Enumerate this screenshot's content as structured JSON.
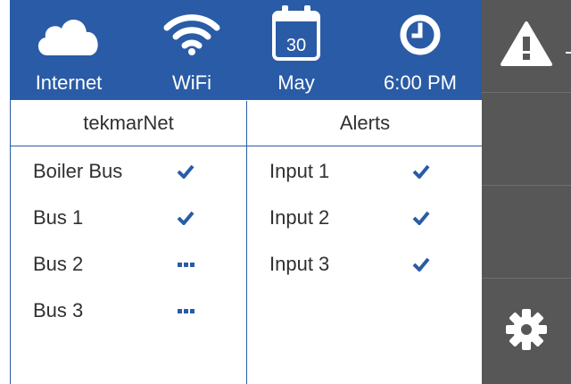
{
  "header": {
    "internet_label": "Internet",
    "wifi_label": "WiFi",
    "date_day": "30",
    "date_month": "May",
    "time": "6:00 PM"
  },
  "left_panel": {
    "title": "tekmarNet",
    "items": [
      {
        "label": "Boiler Bus",
        "status": "check"
      },
      {
        "label": "Bus 1",
        "status": "check"
      },
      {
        "label": "Bus 2",
        "status": "dots"
      },
      {
        "label": "Bus 3",
        "status": "dots"
      }
    ]
  },
  "right_panel": {
    "title": "Alerts",
    "items": [
      {
        "label": "Input 1",
        "status": "check"
      },
      {
        "label": "Input 2",
        "status": "check"
      },
      {
        "label": "Input 3",
        "status": "check"
      }
    ]
  },
  "sidebar": {
    "buttons": [
      "warning-icon",
      "",
      "",
      "gear-icon"
    ]
  },
  "colors": {
    "accent": "#2a5ba6",
    "sidebar": "#575757"
  }
}
